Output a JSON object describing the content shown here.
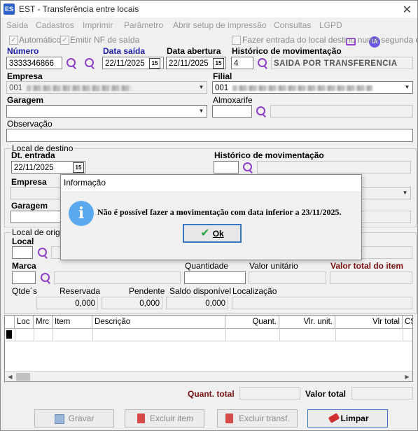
{
  "window": {
    "title": "EST - Transferência entre locais",
    "app_icon": "ES"
  },
  "menu": [
    "Saída",
    "Cadastros",
    "Imprimir",
    "Parâmetro",
    "Abrir setup de impressão",
    "Consultas",
    "LGPD"
  ],
  "menu_ia": "IA",
  "options": {
    "automatico": "Automático",
    "emitir_nf": "Emitir NF de saída",
    "entrada_segunda": "Fazer entrada do local destino numa segunda etapa"
  },
  "header": {
    "numero_label": "Número",
    "numero": "3333346866",
    "data_saida_label": "Data saída",
    "data_saida": "22/11/2025",
    "data_abertura_label": "Data abertura",
    "data_abertura": "22/11/2025",
    "historico_label": "Histórico de movimentação",
    "historico_codigo": "4",
    "historico_desc": "SAIDA POR TRANSFERENCIA",
    "calendar_glyph": "15"
  },
  "empresa": {
    "label": "Empresa",
    "value": "001"
  },
  "filial": {
    "label": "Filial",
    "value": "001"
  },
  "garagem": {
    "label": "Garagem",
    "value": ""
  },
  "almoxarife": {
    "label": "Almoxarife",
    "value": ""
  },
  "observacao": {
    "label": "Observação",
    "value": ""
  },
  "destino": {
    "group_label": "Local de destino",
    "dt_entrada_label": "Dt. entrada",
    "dt_entrada": "22/11/2025",
    "historico_label": "Histórico de movimentação",
    "empresa_label": "Empresa",
    "garagem_label": "Garagem"
  },
  "origem": {
    "group_label": "Local de origem",
    "local_label": "Local",
    "marca_label": "Marca",
    "quantidade_label": "Quantidade",
    "valor_unitario_label": "Valor unitário",
    "valor_total_item_label": "Valor total do item",
    "qtdes_label": "Qtde´s",
    "reservada_label": "Reservada",
    "reservada": "0,000",
    "pendente_label": "Pendente",
    "pendente": "0,000",
    "saldo_label": "Saldo disponível",
    "saldo": "0,000",
    "localizacao_label": "Localização"
  },
  "grid": {
    "columns": [
      "Loc",
      "Mrc",
      "Item",
      "Descrição",
      "Quant.",
      "Vlr. unit.",
      "Vlr total",
      "CS"
    ]
  },
  "totals": {
    "quant_total_label": "Quant. total",
    "valor_total_label": "Valor total"
  },
  "buttons": {
    "gravar": "Gravar",
    "excluir_item": "Excluir item",
    "excluir_transf": "Excluir transf.",
    "limpar": "Limpar"
  },
  "dialog": {
    "title": "Informação",
    "message": "Não é possível fazer a movimentação com data inferior a 23/11/2025.",
    "ok": "Ok"
  },
  "colors": {
    "label_blue": "#1a1aa8",
    "label_maroon": "#7a1010",
    "search_purple": "#8e3fc7",
    "info_blue": "#5aa8ee",
    "focus_blue": "#3a74c4"
  }
}
